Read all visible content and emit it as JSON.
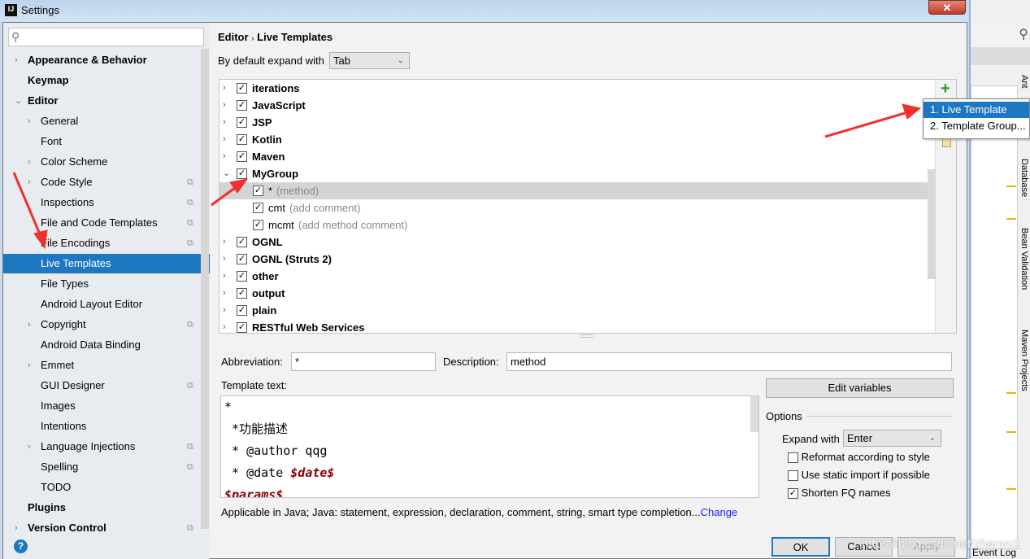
{
  "window": {
    "title": "Settings",
    "app_icon": "IJ",
    "close": "✕"
  },
  "sidebar": {
    "search_placeholder": "",
    "items": [
      {
        "label": "Appearance & Behavior",
        "level": 0,
        "arrow": "›",
        "bold": true
      },
      {
        "label": "Keymap",
        "level": 0,
        "bold": true
      },
      {
        "label": "Editor",
        "level": 0,
        "arrow": "⌄",
        "bold": true
      },
      {
        "label": "General",
        "level": 1,
        "arrow": "›"
      },
      {
        "label": "Font",
        "level": 1
      },
      {
        "label": "Color Scheme",
        "level": 1,
        "arrow": "›"
      },
      {
        "label": "Code Style",
        "level": 1,
        "arrow": "›",
        "copy": true
      },
      {
        "label": "Inspections",
        "level": 1,
        "copy": true
      },
      {
        "label": "File and Code Templates",
        "level": 1,
        "copy": true
      },
      {
        "label": "File Encodings",
        "level": 1,
        "copy": true
      },
      {
        "label": "Live Templates",
        "level": 1,
        "selected": true
      },
      {
        "label": "File Types",
        "level": 1
      },
      {
        "label": "Android Layout Editor",
        "level": 1
      },
      {
        "label": "Copyright",
        "level": 1,
        "arrow": "›",
        "copy": true
      },
      {
        "label": "Android Data Binding",
        "level": 1
      },
      {
        "label": "Emmet",
        "level": 1,
        "arrow": "›"
      },
      {
        "label": "GUI Designer",
        "level": 1,
        "copy": true
      },
      {
        "label": "Images",
        "level": 1
      },
      {
        "label": "Intentions",
        "level": 1
      },
      {
        "label": "Language Injections",
        "level": 1,
        "arrow": "›",
        "copy": true
      },
      {
        "label": "Spelling",
        "level": 1,
        "copy": true
      },
      {
        "label": "TODO",
        "level": 1
      },
      {
        "label": "Plugins",
        "level": 0,
        "bold": true
      },
      {
        "label": "Version Control",
        "level": 0,
        "arrow": "›",
        "bold": true,
        "copy": true
      }
    ]
  },
  "breadcrumb": {
    "parent": "Editor",
    "sep": "›",
    "current": "Live Templates"
  },
  "expand_default": {
    "label": "By default expand with",
    "value": "Tab"
  },
  "templates": [
    {
      "name": "iterations",
      "group": true,
      "checked": true
    },
    {
      "name": "JavaScript",
      "group": true,
      "checked": true
    },
    {
      "name": "JSP",
      "group": true,
      "checked": true
    },
    {
      "name": "Kotlin",
      "group": true,
      "checked": true
    },
    {
      "name": "Maven",
      "group": true,
      "checked": true
    },
    {
      "name": "MyGroup",
      "group": true,
      "checked": true,
      "expanded": true
    },
    {
      "name": "*",
      "desc": "(method)",
      "checked": true,
      "selected": true
    },
    {
      "name": "cmt",
      "desc": "(add comment)",
      "checked": true
    },
    {
      "name": "mcmt",
      "desc": "(add method comment)",
      "checked": true
    },
    {
      "name": "OGNL",
      "group": true,
      "checked": true
    },
    {
      "name": "OGNL (Struts 2)",
      "group": true,
      "checked": true
    },
    {
      "name": "other",
      "group": true,
      "checked": true
    },
    {
      "name": "output",
      "group": true,
      "checked": true
    },
    {
      "name": "plain",
      "group": true,
      "checked": true
    },
    {
      "name": "RESTful Web Services",
      "group": true,
      "checked": true
    }
  ],
  "add_menu": {
    "items": [
      "1. Live Template",
      "2. Template Group..."
    ]
  },
  "form": {
    "abbreviation_label": "Abbreviation:",
    "abbreviation": "*",
    "description_label": "Description:",
    "description": "method",
    "template_text_label": "Template text:",
    "template_lines": [
      [
        "*",
        ""
      ],
      [
        " *功能描述",
        ""
      ],
      [
        " * @author qqg",
        ""
      ],
      [
        " * @date ",
        "$date$"
      ],
      [
        "",
        "$params$"
      ]
    ],
    "applicable": "Applicable in Java; Java: statement, expression, declaration, comment, string, smart type completion...",
    "change_link": "Change"
  },
  "options": {
    "edit_variables": "Edit variables",
    "title": "Options",
    "expand_label": "Expand with",
    "expand_value": "Enter",
    "checks": [
      {
        "label": "Reformat according to style",
        "checked": false
      },
      {
        "label": "Use static import if possible",
        "checked": false
      },
      {
        "label": "Shorten FQ names",
        "checked": true
      }
    ]
  },
  "buttons": {
    "ok": "OK",
    "cancel": "Cancel",
    "apply": "Apply",
    "help": "?"
  },
  "ide": {
    "tool_windows": [
      "Ant",
      "Database",
      "Bean Validation",
      "Maven Projects"
    ],
    "event_log": "Event Log"
  },
  "watermark": "https://blog.csdn.net/zhanyu1"
}
